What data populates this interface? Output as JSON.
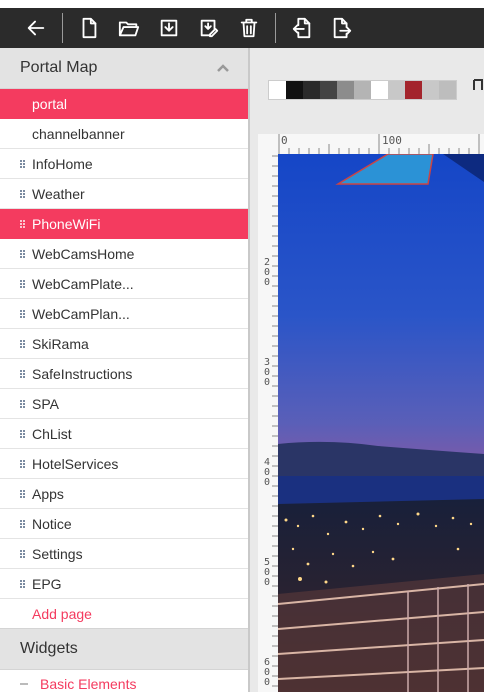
{
  "toolbar": {
    "buttons": [
      "back",
      "new-page",
      "open-folder",
      "save",
      "save-as",
      "delete",
      "import",
      "export"
    ]
  },
  "sidebar": {
    "portal_map_title": "Portal Map",
    "pages": [
      {
        "label": "portal",
        "active": true,
        "grip": false
      },
      {
        "label": "channelbanner",
        "active": false,
        "grip": false
      },
      {
        "label": "InfoHome",
        "active": false,
        "grip": true
      },
      {
        "label": "Weather",
        "active": false,
        "grip": true
      },
      {
        "label": "PhoneWiFi",
        "active": true,
        "grip": true
      },
      {
        "label": "WebCamsHome",
        "active": false,
        "grip": true
      },
      {
        "label": "WebCamPlate...",
        "active": false,
        "grip": true
      },
      {
        "label": "WebCamPlan...",
        "active": false,
        "grip": true
      },
      {
        "label": "SkiRama",
        "active": false,
        "grip": true
      },
      {
        "label": "SafeInstructions",
        "active": false,
        "grip": true
      },
      {
        "label": "SPA",
        "active": false,
        "grip": true
      },
      {
        "label": "ChList",
        "active": false,
        "grip": true
      },
      {
        "label": "HotelServices",
        "active": false,
        "grip": true
      },
      {
        "label": "Apps",
        "active": false,
        "grip": true
      },
      {
        "label": "Notice",
        "active": false,
        "grip": true
      },
      {
        "label": "Settings",
        "active": false,
        "grip": true
      },
      {
        "label": "EPG",
        "active": false,
        "grip": true
      }
    ],
    "add_page_label": "Add page",
    "widgets_title": "Widgets",
    "basic_elements_label": "Basic Elements"
  },
  "canvas": {
    "swatch_colors": [
      "#ffffff",
      "#111111",
      "#2a2a2a",
      "#444444",
      "#8c8c8c",
      "#b4b4b4",
      "#ffffff",
      "#c8c8c8",
      "#a3242c",
      "#c8c8c8",
      "#bdbdbd"
    ],
    "ruler_h_labels": [
      "0",
      "100"
    ],
    "ruler_v_labels": [
      "200",
      "300",
      "400",
      "500",
      "600"
    ],
    "accent": "#f43b5f"
  }
}
